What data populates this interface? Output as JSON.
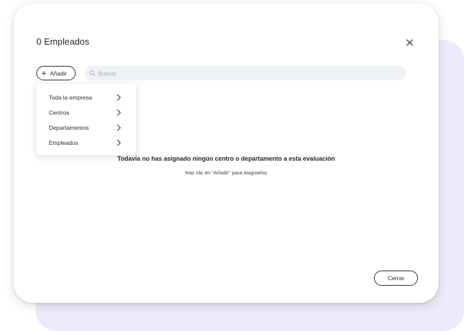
{
  "modal": {
    "title": "0 Empleados",
    "close_icon": "close-icon"
  },
  "toolbar": {
    "add_label": "Añadir",
    "add_icon": "plus-icon",
    "search_placeholder": "Buscar",
    "search_value": "",
    "search_icon": "search-icon"
  },
  "dropdown": {
    "items": [
      {
        "label": "Toda la empresa",
        "icon": "chevron-right-icon"
      },
      {
        "label": "Centros",
        "icon": "chevron-right-icon"
      },
      {
        "label": "Departamentos",
        "icon": "chevron-right-icon"
      },
      {
        "label": "Empleados",
        "icon": "chevron-right-icon"
      }
    ]
  },
  "empty_state": {
    "title": "Todavía no has asignado ningún centro o departamento a esta evaluación",
    "subtitle": "Haz clic en \"Añadir\" para asignarlos"
  },
  "footer": {
    "close_label": "Cerrar"
  },
  "colors": {
    "accent_background": "#ebebfa",
    "search_background": "#eef1f7",
    "text": "#24242e"
  }
}
